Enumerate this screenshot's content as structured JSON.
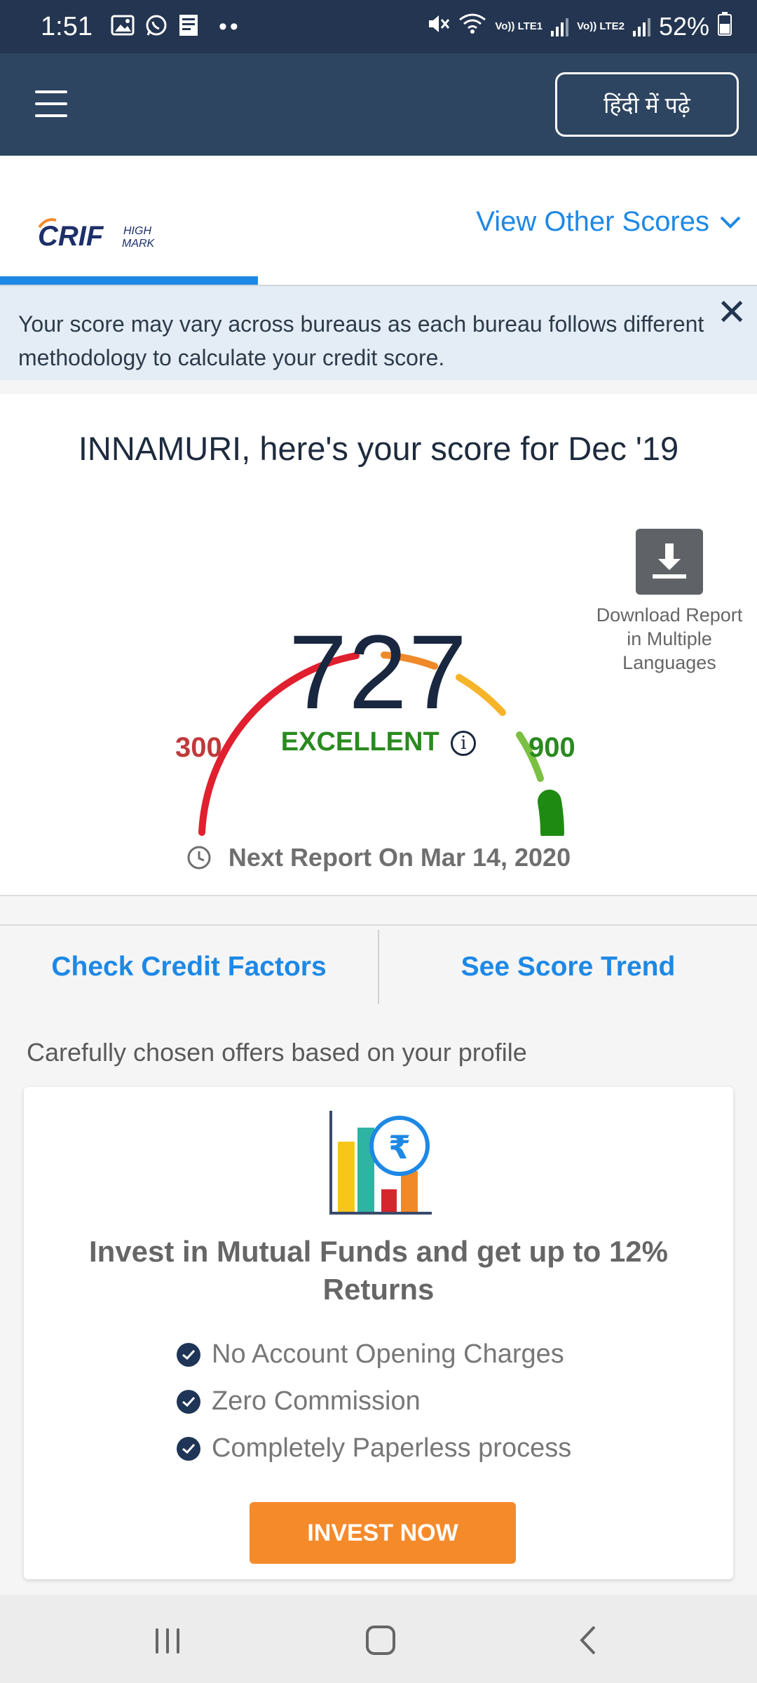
{
  "status_bar": {
    "time": "1:51",
    "network1": "Vo)) LTE1",
    "network2": "Vo)) LTE2",
    "battery": "52%"
  },
  "app_bar": {
    "language_button": "हिंदी में पढ़े"
  },
  "bureau_tabs": {
    "other_scores_label": "View Other Scores"
  },
  "notice": {
    "text": "Your score may vary across bureaus as each bureau follows different methodology to calculate your credit score.",
    "close": "✕"
  },
  "score_card": {
    "greeting": "INNAMURI, here's your score for Dec '19",
    "score": "727",
    "rating": "EXCELLENT",
    "min": "300",
    "max": "900",
    "download_label": "Download Report in Multiple Languages",
    "next_report": "Next Report On Mar 14, 2020"
  },
  "actions": {
    "credit_factors": "Check Credit Factors",
    "score_trend": "See Score Trend"
  },
  "offers": {
    "section_title": "Carefully chosen offers based on your profile",
    "card_title": "Invest in Mutual Funds and get up to 12% Returns",
    "features": [
      "No Account Opening Charges",
      "Zero Commission",
      "Completely Paperless process"
    ],
    "cta": "INVEST NOW"
  },
  "colors": {
    "appbar": "#2e4561",
    "statusbar": "#233550",
    "accent_blue": "#1e88e5",
    "cta_orange": "#f58a2b",
    "excellent_green": "#2a8a1f",
    "low_red": "#c0393b"
  }
}
